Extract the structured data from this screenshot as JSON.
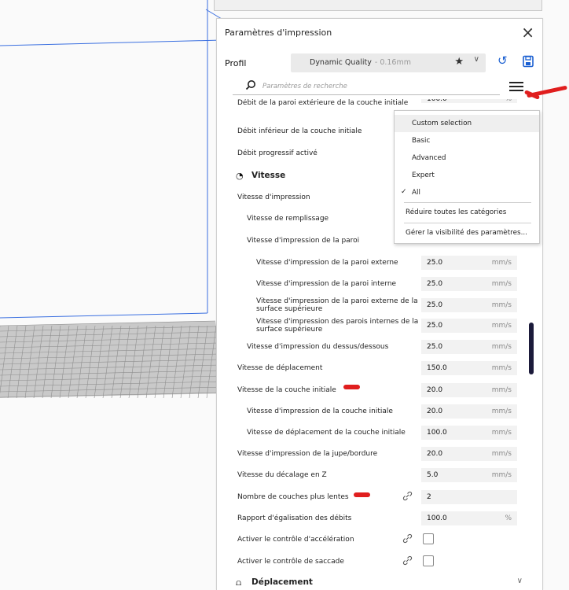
{
  "panel": {
    "title": "Paramètres d'impression",
    "profile_label": "Profil",
    "profile_name": "Dynamic Quality",
    "profile_sub": "- 0.16mm",
    "search_placeholder": "Paramètres de recherche"
  },
  "icons": {
    "close": "×",
    "star": "★",
    "caret": "∨",
    "reset": "↺",
    "link": "🔗",
    "speed": "◔",
    "travel": "⩍",
    "chevron": "∨",
    "check": "✓"
  },
  "rows": [
    {
      "label": "Débit de la paroi extérieure de la couche initiale",
      "value": "100.0",
      "unit": "%"
    },
    {
      "label": "Débit inférieur de la couche initiale"
    },
    {
      "label": "Débit progressif activé"
    },
    {
      "label": "Vitesse"
    },
    {
      "label": "Vitesse d'impression"
    },
    {
      "label": "Vitesse de remplissage"
    },
    {
      "label": "Vitesse d'impression de la paroi"
    },
    {
      "label": "Vitesse d'impression de la paroi externe",
      "value": "25.0",
      "unit": "mm/s"
    },
    {
      "label": "Vitesse d'impression de la paroi interne",
      "value": "25.0",
      "unit": "mm/s"
    },
    {
      "label": "Vitesse d'impression de la paroi externe de la surface supérieure",
      "value": "25.0",
      "unit": "mm/s"
    },
    {
      "label": "Vitesse d'impression des parois internes de la surface supérieure",
      "value": "25.0",
      "unit": "mm/s"
    },
    {
      "label": "Vitesse d'impression du dessus/dessous",
      "value": "25.0",
      "unit": "mm/s"
    },
    {
      "label": "Vitesse de déplacement",
      "value": "150.0",
      "unit": "mm/s"
    },
    {
      "label": "Vitesse de la couche initiale",
      "value": "20.0",
      "unit": "mm/s"
    },
    {
      "label": "Vitesse d'impression de la couche initiale",
      "value": "20.0",
      "unit": "mm/s"
    },
    {
      "label": "Vitesse de déplacement de la couche initiale",
      "value": "100.0",
      "unit": "mm/s"
    },
    {
      "label": "Vitesse d'impression de la jupe/bordure",
      "value": "20.0",
      "unit": "mm/s"
    },
    {
      "label": "Vitesse du décalage en Z",
      "value": "5.0",
      "unit": "mm/s"
    },
    {
      "label": "Nombre de couches plus lentes",
      "value": "2",
      "unit": ""
    },
    {
      "label": "Rapport d'égalisation des débits",
      "value": "100.0",
      "unit": "%"
    },
    {
      "label": "Activer le contrôle d'accélération"
    },
    {
      "label": "Activer le contrôle de saccade"
    },
    {
      "label": "Déplacement"
    }
  ],
  "dropdown": {
    "items": [
      "Custom selection",
      "Basic",
      "Advanced",
      "Expert",
      "All",
      "Réduire toutes les catégories",
      "Gérer la visibilité des paramètres..."
    ]
  }
}
